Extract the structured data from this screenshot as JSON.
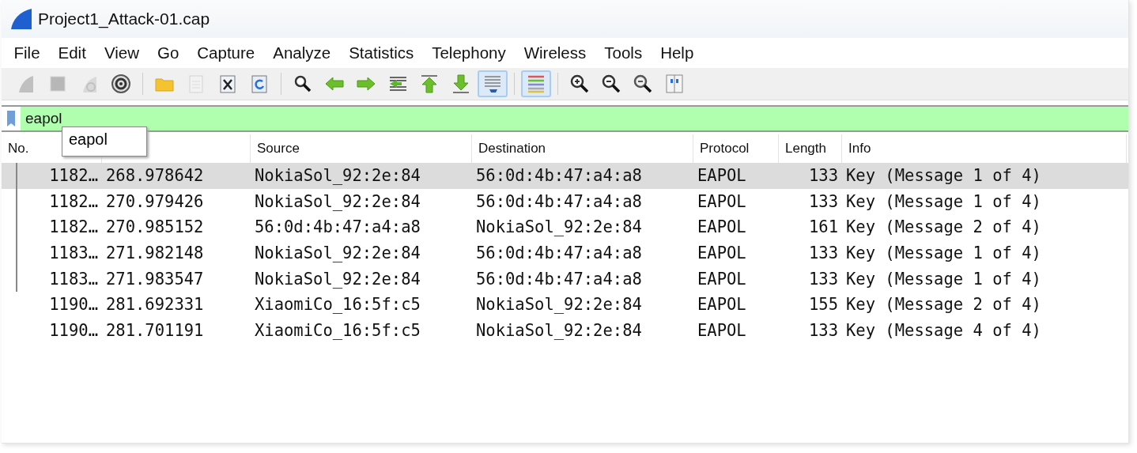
{
  "window": {
    "title": "Project1_Attack-01.cap"
  },
  "menu": [
    "File",
    "Edit",
    "View",
    "Go",
    "Capture",
    "Analyze",
    "Statistics",
    "Telephony",
    "Wireless",
    "Tools",
    "Help"
  ],
  "toolbar": [
    [
      {
        "kind": "start",
        "disabled": true
      },
      {
        "kind": "stop",
        "disabled": true
      },
      {
        "kind": "restart",
        "disabled": true
      },
      {
        "kind": "options",
        "disabled": false
      }
    ],
    [
      {
        "kind": "open",
        "disabled": false
      },
      {
        "kind": "save",
        "disabled": true
      },
      {
        "kind": "close",
        "disabled": false
      },
      {
        "kind": "reload",
        "disabled": false
      }
    ],
    [
      {
        "kind": "find",
        "disabled": false
      },
      {
        "kind": "back",
        "disabled": false
      },
      {
        "kind": "forward",
        "disabled": false
      },
      {
        "kind": "goto",
        "disabled": false
      },
      {
        "kind": "first",
        "disabled": false
      },
      {
        "kind": "last",
        "disabled": false
      },
      {
        "kind": "autoscroll",
        "disabled": false,
        "checked": true
      }
    ],
    [
      {
        "kind": "colorize",
        "disabled": false,
        "checked": true
      }
    ],
    [
      {
        "kind": "zoom-in",
        "disabled": false
      },
      {
        "kind": "zoom-out",
        "disabled": false
      },
      {
        "kind": "zoom-normal",
        "disabled": false
      },
      {
        "kind": "resize",
        "disabled": false
      }
    ]
  ],
  "filter": {
    "value": "eapol",
    "valid": true
  },
  "autocomplete": [
    "eapol"
  ],
  "table": {
    "columns": [
      "No.",
      "",
      "Source",
      "Destination",
      "Protocol",
      "Length",
      "Info"
    ],
    "rows": [
      {
        "cells": [
          "1182…",
          "268.978642",
          "NokiaSol_92:2e:84",
          "56:0d:4b:47:a4:a8",
          "EAPOL",
          "133",
          "Key (Message 1 of 4)"
        ],
        "selected": true,
        "related": true
      },
      {
        "cells": [
          "1182…",
          "270.979426",
          "NokiaSol_92:2e:84",
          "56:0d:4b:47:a4:a8",
          "EAPOL",
          "133",
          "Key (Message 1 of 4)"
        ],
        "selected": false,
        "related": true
      },
      {
        "cells": [
          "1182…",
          "270.985152",
          "56:0d:4b:47:a4:a8",
          "NokiaSol_92:2e:84",
          "EAPOL",
          "161",
          "Key (Message 2 of 4)"
        ],
        "selected": false,
        "related": true
      },
      {
        "cells": [
          "1183…",
          "271.982148",
          "NokiaSol_92:2e:84",
          "56:0d:4b:47:a4:a8",
          "EAPOL",
          "133",
          "Key (Message 1 of 4)"
        ],
        "selected": false,
        "related": true
      },
      {
        "cells": [
          "1183…",
          "271.983547",
          "NokiaSol_92:2e:84",
          "56:0d:4b:47:a4:a8",
          "EAPOL",
          "133",
          "Key (Message 1 of 4)"
        ],
        "selected": false,
        "related": true
      },
      {
        "cells": [
          "1190…",
          "281.692331",
          "XiaomiCo_16:5f:c5",
          "NokiaSol_92:2e:84",
          "EAPOL",
          "155",
          "Key (Message 2 of 4)"
        ],
        "selected": false,
        "related": false
      },
      {
        "cells": [
          "1190…",
          "281.701191",
          "XiaomiCo_16:5f:c5",
          "NokiaSol_92:2e:84",
          "EAPOL",
          "133",
          "Key (Message 4 of 4)"
        ],
        "selected": false,
        "related": false
      }
    ]
  }
}
